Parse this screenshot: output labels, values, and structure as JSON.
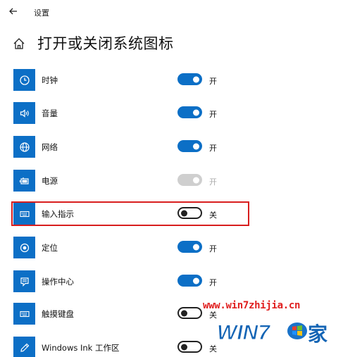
{
  "window": {
    "title": "设置"
  },
  "page": {
    "title": "打开或关闭系统图标"
  },
  "items": [
    {
      "label": "时钟",
      "icon": "clock-icon",
      "state": "on",
      "state_label": "开"
    },
    {
      "label": "音量",
      "icon": "volume-icon",
      "state": "on",
      "state_label": "开"
    },
    {
      "label": "网络",
      "icon": "network-icon",
      "state": "on",
      "state_label": "开"
    },
    {
      "label": "电源",
      "icon": "battery-icon",
      "state": "disabled",
      "state_label": "开"
    },
    {
      "label": "输入指示",
      "icon": "keyboard-icon",
      "state": "off",
      "state_label": "关"
    },
    {
      "label": "定位",
      "icon": "location-icon",
      "state": "on",
      "state_label": "开"
    },
    {
      "label": "操作中心",
      "icon": "action-center-icon",
      "state": "on",
      "state_label": "开"
    },
    {
      "label": "触摸键盘",
      "icon": "touch-keyboard-icon",
      "state": "off",
      "state_label": "关"
    },
    {
      "label": "Windows Ink 工作区",
      "icon": "pen-icon",
      "state": "off",
      "state_label": "关"
    }
  ],
  "watermark": {
    "url": "www.win7zhijia.cn",
    "logo_text": "WIN7",
    "logo_suffix": "家"
  },
  "colors": {
    "accent": "#0c6fc6",
    "highlight": "#d81e1e",
    "watermark": "#e01f1f"
  }
}
